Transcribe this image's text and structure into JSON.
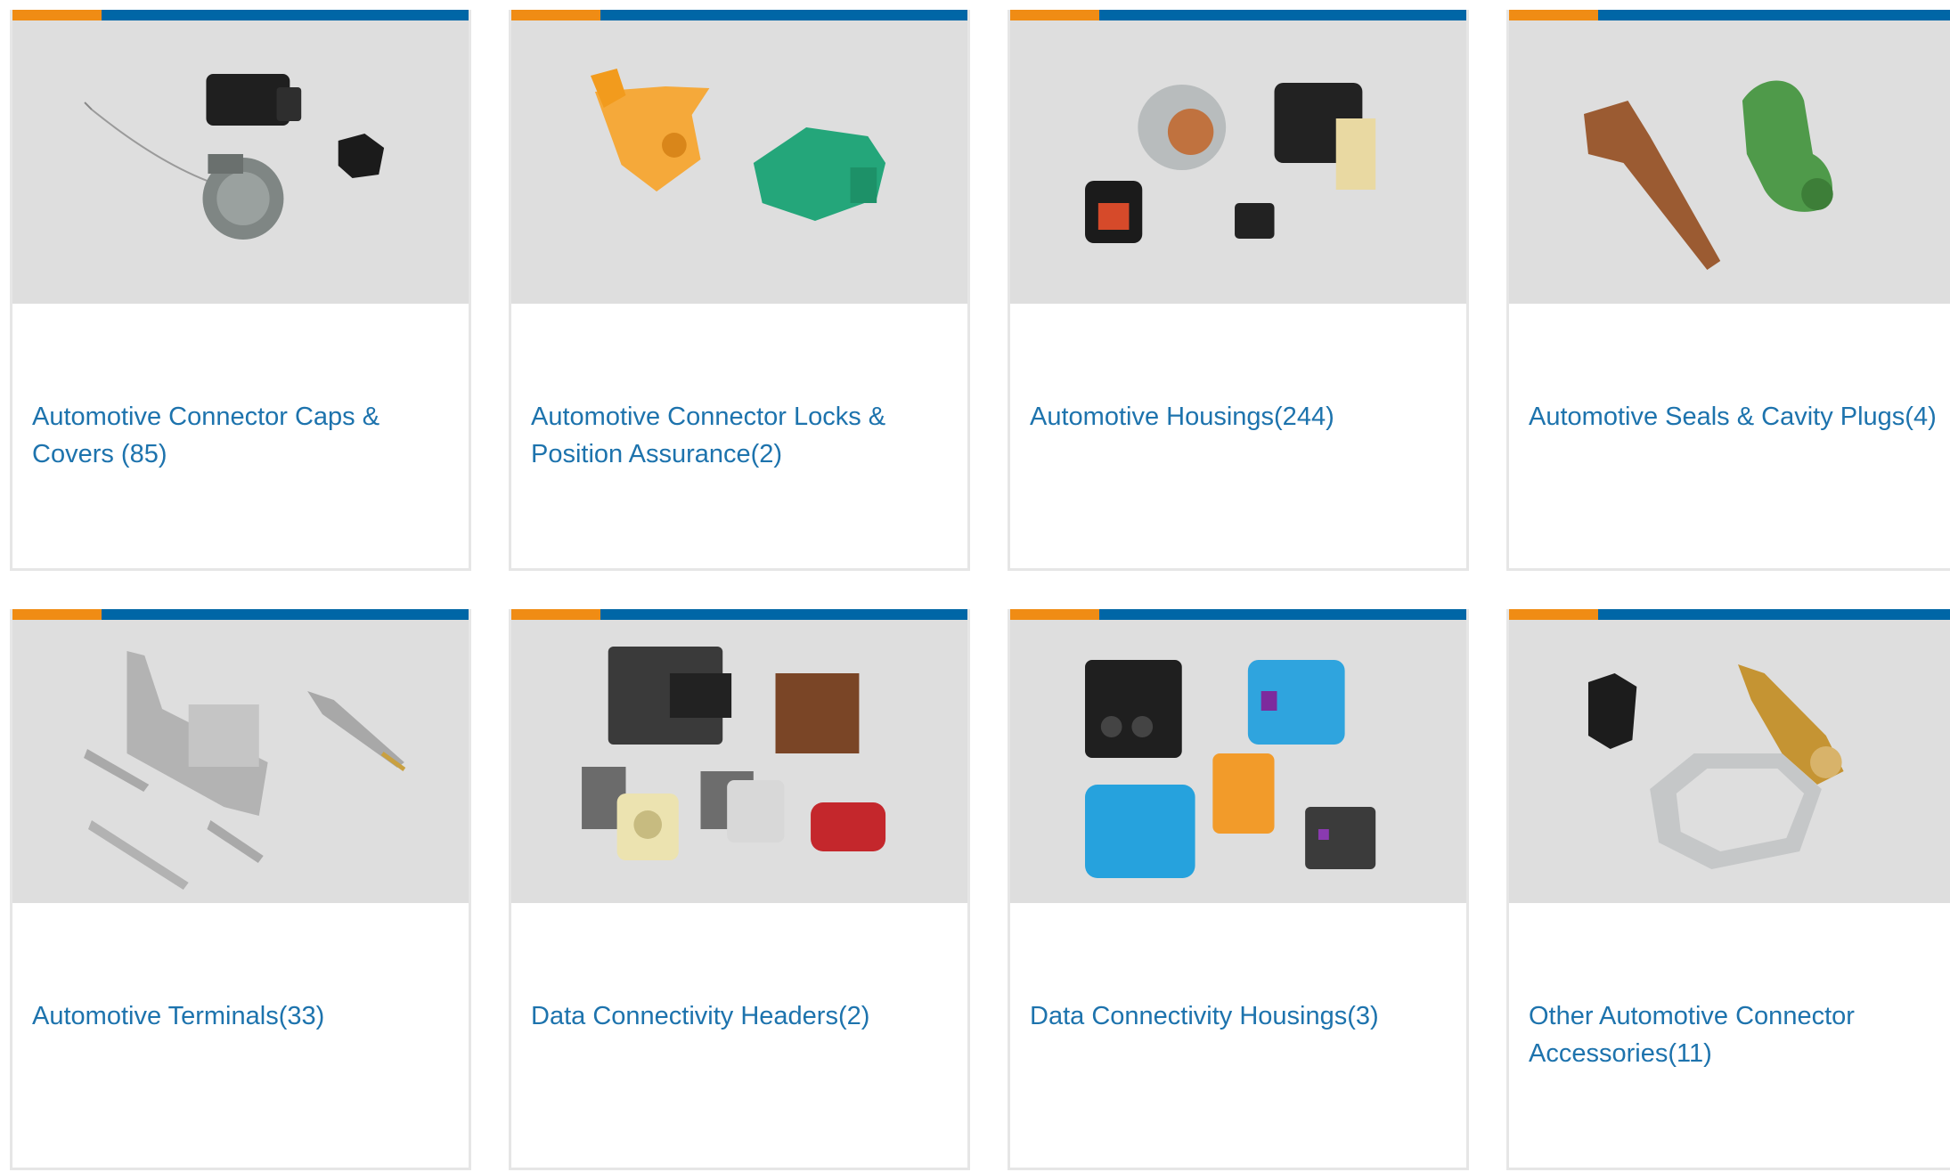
{
  "colors": {
    "accent_orange": "#f08c14",
    "accent_blue": "#0066a6",
    "link": "#1d73ad",
    "card_border": "#e6e6e6",
    "photo_bg": "#dedede"
  },
  "categories": [
    {
      "label": "Automotive Connector Caps & Covers (85)",
      "image": "caps-covers-image"
    },
    {
      "label": "Automotive Connector Locks & Position Assurance(2)",
      "image": "locks-position-assurance-image"
    },
    {
      "label": "Automotive Housings(244)",
      "image": "housings-image"
    },
    {
      "label": "Automotive Seals & Cavity Plugs(4)",
      "image": "seals-cavity-plugs-image"
    },
    {
      "label": "Automotive Terminals(33)",
      "image": "terminals-image"
    },
    {
      "label": "Data Connectivity Headers(2)",
      "image": "data-headers-image"
    },
    {
      "label": "Data Connectivity Housings(3)",
      "image": "data-housings-image"
    },
    {
      "label": "Other Automotive Connector Accessories(11)",
      "image": "other-accessories-image"
    }
  ]
}
